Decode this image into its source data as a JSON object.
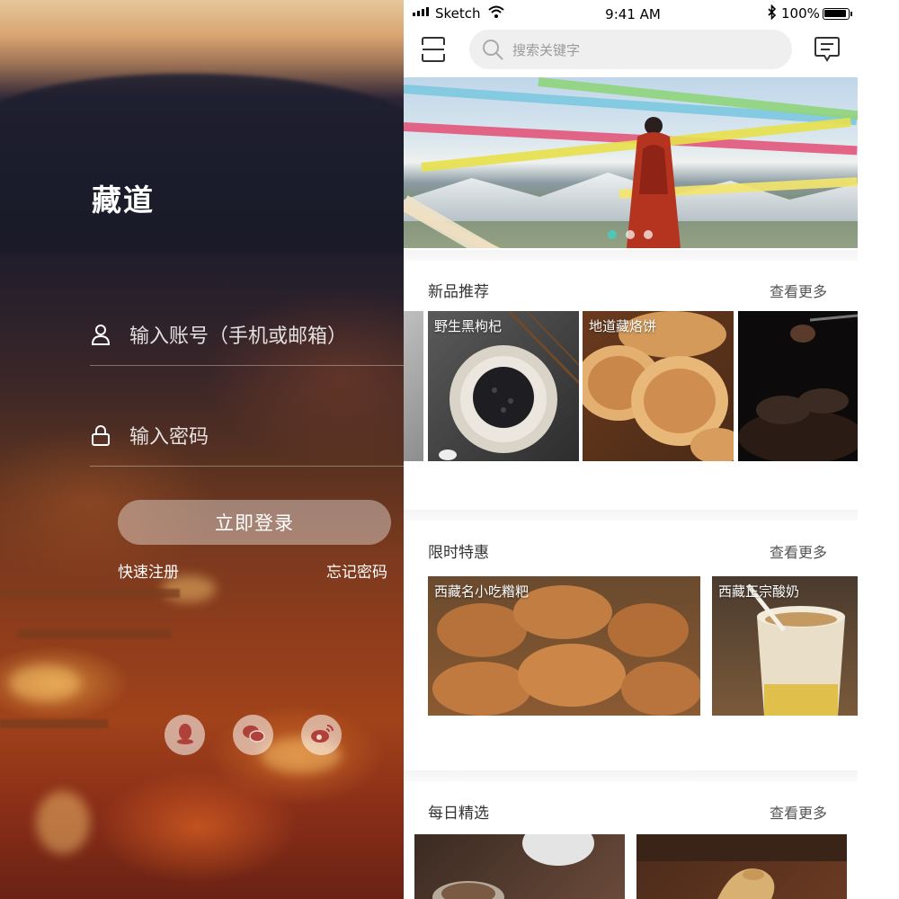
{
  "login": {
    "brand": "藏道",
    "account_placeholder": "输入账号（手机或邮箱）",
    "password_placeholder": "输入密码",
    "login_button": "立即登录",
    "register_link": "快速注册",
    "forgot_link": "忘记密码",
    "social": [
      {
        "icon": "qq-icon"
      },
      {
        "icon": "wechat-icon"
      },
      {
        "icon": "weibo-icon"
      }
    ]
  },
  "status_bar": {
    "carrier": "Sketch",
    "time": "9:41 AM",
    "battery": "100%"
  },
  "home": {
    "search_placeholder": "搜索关键字",
    "banner": {
      "dots": 3,
      "active_dot": 1
    },
    "sections": [
      {
        "title": "新品推荐",
        "more": "查看更多",
        "items": [
          {
            "name": ""
          },
          {
            "name": "野生黑枸杞"
          },
          {
            "name": "地道藏烙饼"
          },
          {
            "name": ""
          }
        ]
      },
      {
        "title": "限时特惠",
        "more": "查看更多",
        "items": [
          {
            "name": "西藏名小吃糌粑"
          },
          {
            "name": "西藏正宗酸奶"
          }
        ]
      },
      {
        "title": "每日精选",
        "more": "查看更多",
        "items": [
          {
            "name": ""
          },
          {
            "name": ""
          }
        ]
      }
    ]
  },
  "colors": {
    "accent": "#4ec7b6",
    "search_bg": "#efefef",
    "text_dark": "#333333"
  }
}
